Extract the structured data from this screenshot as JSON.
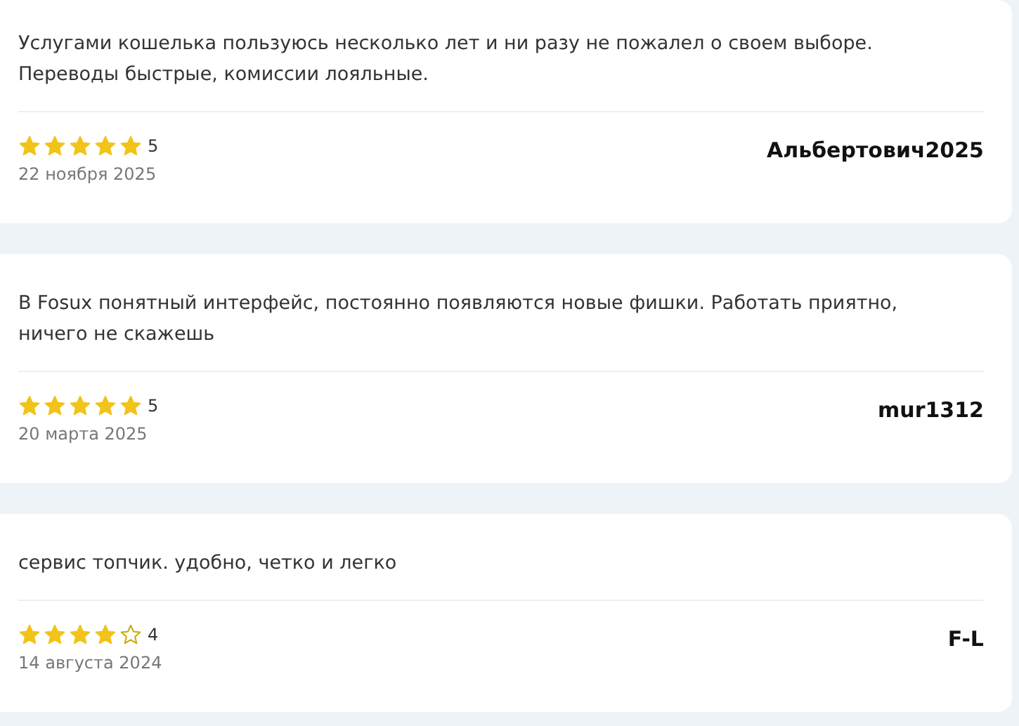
{
  "reviews": [
    {
      "text": "Услугами кошелька пользуюсь несколько лет и ни разу не пожалел о своем выборе. Переводы быстрые, комиссии лояльные.",
      "stars": 5,
      "rating": "5",
      "date": "22 ноября 2025",
      "author": "Альбертович2025"
    },
    {
      "text": "В Fosux понятный интерфейс, постоянно появляются новые фишки. Работать приятно, ничего не скажешь",
      "stars": 5,
      "rating": "5",
      "date": "20 марта 2025",
      "author": "mur1312"
    },
    {
      "text": "сервис топчик. удобно, четко и легко",
      "stars": 4,
      "rating": "4",
      "date": "14 августа 2024",
      "author": "F-L"
    }
  ]
}
